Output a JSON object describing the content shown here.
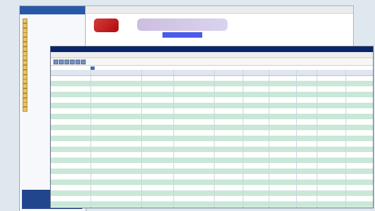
{
  "colors": {
    "sidebar_bg": "#f7f8fb",
    "header_blue": "#0a246a",
    "row_alt": "#c9e8d7",
    "logo_red": "#c61e1e",
    "banner_purple": "#d0c4e6"
  },
  "sidebar": {
    "title": "",
    "logout_label": "",
    "exit_label": ""
  },
  "browser": {
    "banner_text": ""
  },
  "app": {
    "window_title": "",
    "menus": [],
    "tab_label": ""
  }
}
